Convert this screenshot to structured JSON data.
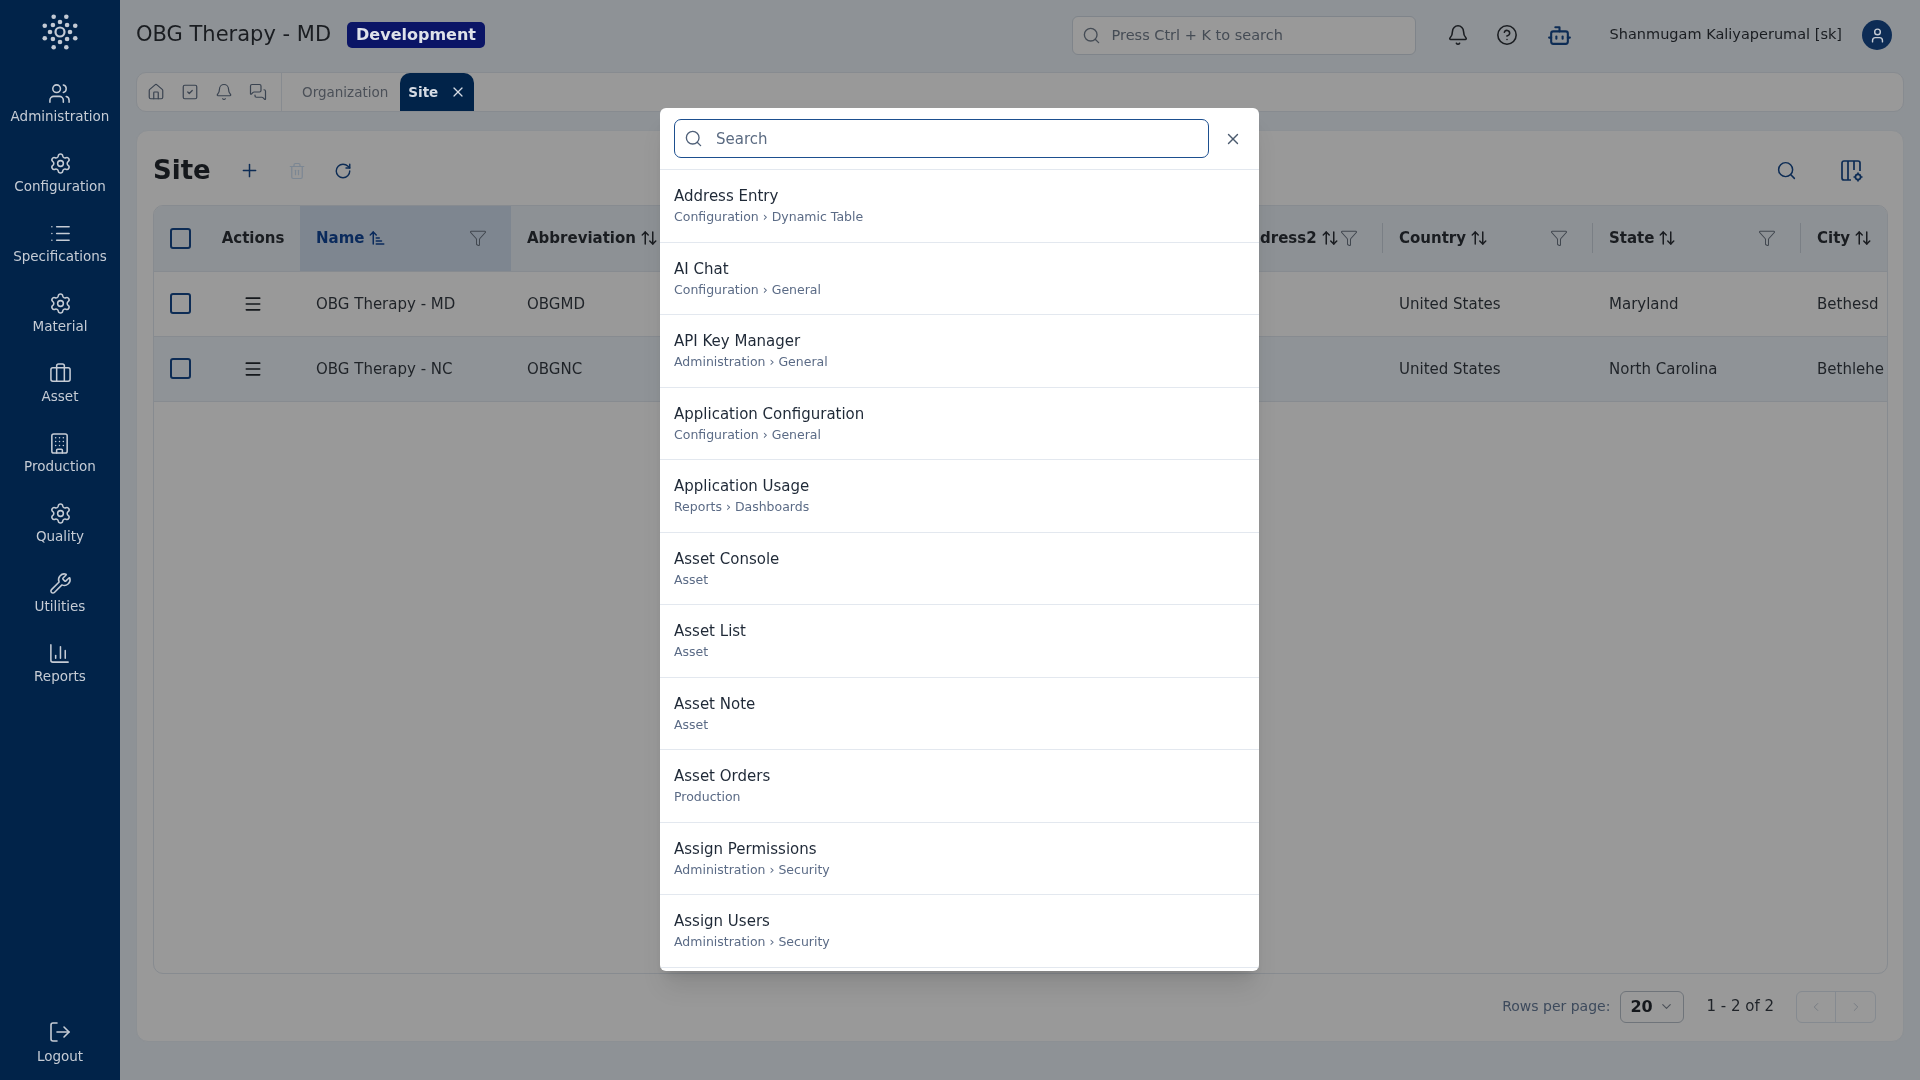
{
  "sidebar": {
    "items": [
      {
        "label": "Administration"
      },
      {
        "label": "Configuration"
      },
      {
        "label": "Specifications"
      },
      {
        "label": "Material"
      },
      {
        "label": "Asset"
      },
      {
        "label": "Production"
      },
      {
        "label": "Quality"
      },
      {
        "label": "Utilities"
      },
      {
        "label": "Reports"
      }
    ],
    "logout": {
      "label": "Logout"
    }
  },
  "header": {
    "title": "OBG Therapy - MD",
    "badge": "Development",
    "search": {
      "placeholder": "Press Ctrl + K to search"
    },
    "user": "Shanmugam Kaliyaperumal [sk]"
  },
  "tabs": [
    {
      "label": "Organization",
      "selected": false
    },
    {
      "label": "Site",
      "selected": true
    }
  ],
  "page": {
    "title": "Site",
    "actions": [
      {
        "kind": "add",
        "disabled": false
      },
      {
        "kind": "delete",
        "disabled": true
      },
      {
        "kind": "refresh",
        "disabled": false
      }
    ]
  },
  "table": {
    "header_checked": false,
    "columns": [
      {
        "label": "Actions"
      },
      {
        "label": "Name",
        "sorted": true,
        "filter": true
      },
      {
        "label": "Abbreviation",
        "sorted": false,
        "filter": false
      },
      {
        "label": "dress2",
        "sorted": false,
        "filter": true
      },
      {
        "label": "Country",
        "sorted": false,
        "filter": true
      },
      {
        "label": "State",
        "sorted": false,
        "filter": true
      },
      {
        "label": "City",
        "sorted": false,
        "filter": false
      }
    ],
    "rows": [
      {
        "checked": false,
        "cells": [
          "",
          "OBG Therapy - MD",
          "OBGMD",
          "",
          "United States",
          "Maryland",
          "Bethesd"
        ]
      },
      {
        "checked": false,
        "cells": [
          "",
          "OBG Therapy - NC",
          "OBGNC",
          "",
          "United States",
          "North Carolina",
          "Bethlehe"
        ]
      }
    ]
  },
  "pagination": {
    "label": "Rows per page:",
    "rows_per_page": "20",
    "range": "1 - 2 of 2",
    "prev_disabled": true,
    "next_disabled": true
  },
  "dialog": {
    "search": {
      "placeholder": "Search"
    },
    "results": [
      {
        "title": "Address Entry",
        "path": "Configuration › Dynamic Table"
      },
      {
        "title": "AI Chat",
        "path": "Configuration › General"
      },
      {
        "title": "API Key Manager",
        "path": "Administration › General"
      },
      {
        "title": "Application Configuration",
        "path": "Configuration › General"
      },
      {
        "title": "Application Usage",
        "path": "Reports › Dashboards"
      },
      {
        "title": "Asset Console",
        "path": "Asset"
      },
      {
        "title": "Asset List",
        "path": "Asset"
      },
      {
        "title": "Asset Note",
        "path": "Asset"
      },
      {
        "title": "Asset Orders",
        "path": "Production"
      },
      {
        "title": "Assign Permissions",
        "path": "Administration › Security"
      },
      {
        "title": "Assign Users",
        "path": "Administration › Security"
      }
    ]
  }
}
